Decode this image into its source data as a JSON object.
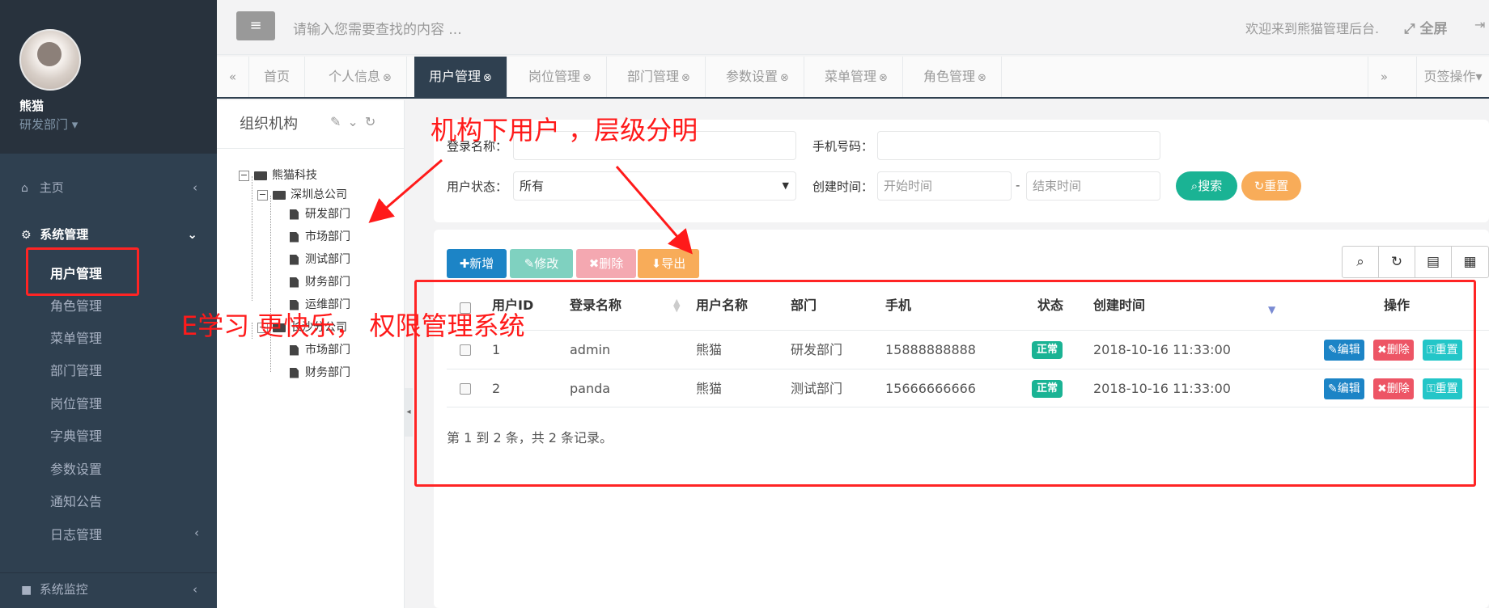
{
  "sidebar": {
    "user_name": "熊猫",
    "user_dept": "研发部门 ▾",
    "items": [
      {
        "label": "主页",
        "icon": "home-icon"
      },
      {
        "label": "系统管理",
        "icon": "gear-icon"
      },
      {
        "label": "系统监控",
        "icon": "video-camera-icon"
      }
    ],
    "sub_items": [
      "用户管理",
      "角色管理",
      "菜单管理",
      "部门管理",
      "岗位管理",
      "字典管理",
      "参数设置",
      "通知公告",
      "日志管理"
    ]
  },
  "topbar": {
    "search_placeholder": "请输入您需要查找的内容 ...",
    "welcome": "欢迎来到熊猫管理后台.",
    "fullscreen": "全屏"
  },
  "tabs": {
    "items": [
      "首页",
      "个人信息",
      "用户管理",
      "岗位管理",
      "部门管理",
      "参数设置",
      "菜单管理",
      "角色管理"
    ],
    "active": "用户管理",
    "ops": "页签操作▾"
  },
  "tree": {
    "title": "组织机构",
    "nodes": [
      "熊猫科技",
      "深圳总公司",
      "研发部门",
      "市场部门",
      "测试部门",
      "财务部门",
      "运维部门",
      "长沙分公司",
      "市场部门",
      "财务部门"
    ]
  },
  "search": {
    "login_name_label": "登录名称：",
    "phone_label": "手机号码：",
    "status_label": "用户状态：",
    "status_value": "所有",
    "created_label": "创建时间：",
    "start_placeholder": "开始时间",
    "dash": "-",
    "end_placeholder": "结束时间",
    "search_btn": "搜索",
    "reset_btn": "重置"
  },
  "toolbar": {
    "add": "新增",
    "edit": "修改",
    "delete": "删除",
    "export": "导出"
  },
  "table": {
    "headers": [
      "用户ID",
      "登录名称",
      "用户名称",
      "部门",
      "手机",
      "状态",
      "创建时间",
      "操作"
    ],
    "rows": [
      {
        "id": "1",
        "login": "admin",
        "name": "熊猫",
        "dept": "研发部门",
        "phone": "15888888888",
        "status": "正常",
        "created": "2018-10-16 11:33:00"
      },
      {
        "id": "2",
        "login": "panda",
        "name": "熊猫",
        "dept": "测试部门",
        "phone": "15666666666",
        "status": "正常",
        "created": "2018-10-16 11:33:00"
      }
    ],
    "op_edit": "编辑",
    "op_delete": "删除",
    "op_reset": "重置",
    "footer": "第 1 到 2 条，共 2 条记录。"
  },
  "annotations": {
    "top": "机构下用户 ，层级分明",
    "left": "E学习 更快乐， 权限管理系统"
  },
  "colors": {
    "sidebar": "#2f4050",
    "primary": "#1c84c6",
    "success": "#1ab394",
    "danger": "#ed5565",
    "warning": "#f8ac59",
    "info": "#23c6c8",
    "annotation": "#ff1a1a"
  }
}
